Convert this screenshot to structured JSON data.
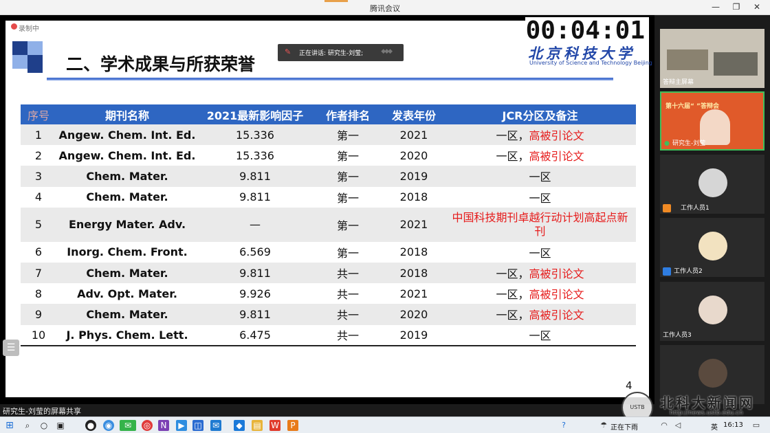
{
  "window": {
    "title": "腾讯会议",
    "minimize": "—",
    "restore": "❐",
    "close": "✕"
  },
  "recording": {
    "label": "录制中"
  },
  "speaking": {
    "label": "正在讲话: 研究生-刘莹;"
  },
  "timer": {
    "value": "00:04:01"
  },
  "logo": {
    "cn": "北京科技大学",
    "en": "University of Science and Technology Beijing"
  },
  "slide": {
    "heading": "二、学术成果与所获荣誉",
    "page_number": "4",
    "table": {
      "headers": [
        "序号",
        "期刊名称",
        "2021最新影响因子",
        "作者排名",
        "发表年份",
        "JCR分区及备注"
      ],
      "rows": [
        {
          "no": "1",
          "journal": "Angew. Chem. Int. Ed.",
          "impact": "15.336",
          "rank": "第一",
          "year": "2021",
          "zone": "一区，",
          "note": "高被引论文"
        },
        {
          "no": "2",
          "journal": "Angew. Chem. Int. Ed.",
          "impact": "15.336",
          "rank": "第一",
          "year": "2020",
          "zone": "一区，",
          "note": "高被引论文"
        },
        {
          "no": "3",
          "journal": "Chem. Mater.",
          "impact": "9.811",
          "rank": "第一",
          "year": "2019",
          "zone": "一区",
          "note": ""
        },
        {
          "no": "4",
          "journal": "Chem. Mater.",
          "impact": "9.811",
          "rank": "第一",
          "year": "2018",
          "zone": "一区",
          "note": ""
        },
        {
          "no": "5",
          "journal": "Energy Mater. Adv.",
          "impact": "—",
          "rank": "第一",
          "year": "2021",
          "zone": "",
          "note": "中国科技期刊卓越行动计划高起点新刊"
        },
        {
          "no": "6",
          "journal": "Inorg. Chem. Front.",
          "impact": "6.569",
          "rank": "第一",
          "year": "2018",
          "zone": "一区",
          "note": ""
        },
        {
          "no": "7",
          "journal": "Chem. Mater.",
          "impact": "9.811",
          "rank": "共一",
          "year": "2018",
          "zone": "一区，",
          "note": "高被引论文"
        },
        {
          "no": "8",
          "journal": "Adv. Opt. Mater.",
          "impact": "9.926",
          "rank": "共一",
          "year": "2021",
          "zone": "一区，",
          "note": "高被引论文"
        },
        {
          "no": "9",
          "journal": "Chem. Mater.",
          "impact": "9.811",
          "rank": "共一",
          "year": "2020",
          "zone": "一区，",
          "note": "高被引论文"
        },
        {
          "no": "10",
          "journal": "J. Phys. Chem. Lett.",
          "impact": "6.475",
          "rank": "共一",
          "year": "2019",
          "zone": "一区",
          "note": ""
        }
      ]
    }
  },
  "share_bar": {
    "label": "研究生-刘莹的屏幕共享"
  },
  "participants": [
    {
      "name": "答辩主屏幕"
    },
    {
      "name": "研究生-刘莹",
      "banner": "第十六届“    ”答辩会"
    },
    {
      "name": "工作人员1"
    },
    {
      "name": "工作人员2"
    },
    {
      "name": "工作人员3"
    },
    {
      "name": ""
    }
  ],
  "taskbar": {
    "weather": "正在下雨",
    "ime": "英",
    "time": "16:13"
  },
  "watermark": {
    "seal": "USTB",
    "cn": "北科大新闻网",
    "url": "http://news.ustb.edu.cn"
  },
  "colors": {
    "header_blue": "#2e66c2",
    "highlight_red": "#e61b1b",
    "active_green": "#3fbf5b"
  }
}
